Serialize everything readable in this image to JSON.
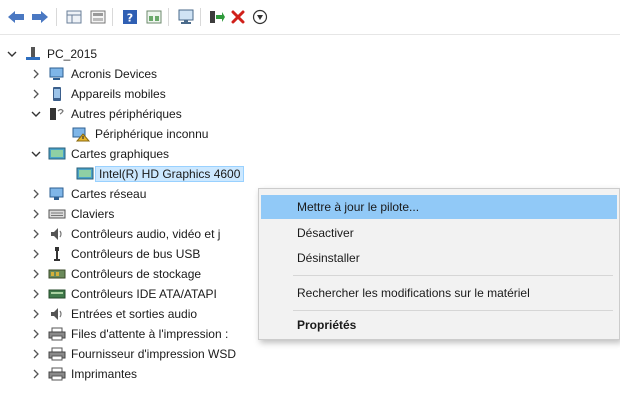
{
  "toolbar": {
    "buttons": [
      {
        "icon": "back-arrow-icon"
      },
      {
        "icon": "forward-arrow-icon"
      },
      {
        "icon": "properties-grid-icon"
      },
      {
        "icon": "details-pane-icon"
      },
      {
        "icon": "help-icon"
      },
      {
        "icon": "view-icon"
      },
      {
        "icon": "monitor-scan-icon"
      },
      {
        "icon": "add-driver-icon"
      },
      {
        "icon": "uninstall-x-icon"
      },
      {
        "icon": "down-arrow-circle-icon"
      }
    ]
  },
  "tree": {
    "root": "PC_2015",
    "items": [
      {
        "label": "Acronis Devices",
        "state": "collapsed",
        "icon": "device-icon"
      },
      {
        "label": "Appareils mobiles",
        "state": "collapsed",
        "icon": "mobile-icon"
      },
      {
        "label": "Autres périphériques",
        "state": "expanded",
        "icon": "other-devices-icon"
      },
      {
        "label": "Périphérique inconnu",
        "state": "leaf",
        "icon": "unknown-device-icon"
      },
      {
        "label": "Cartes graphiques",
        "state": "expanded",
        "icon": "display-adapter-icon"
      },
      {
        "label": "Intel(R) HD Graphics 4600",
        "state": "leaf",
        "icon": "display-adapter-icon",
        "selected": true
      },
      {
        "label": "Cartes réseau",
        "state": "collapsed",
        "icon": "network-adapter-icon"
      },
      {
        "label": "Claviers",
        "state": "collapsed",
        "icon": "keyboard-icon"
      },
      {
        "label": "Contrôleurs audio, vidéo et j",
        "state": "collapsed",
        "icon": "speaker-icon"
      },
      {
        "label": "Contrôleurs de bus USB",
        "state": "collapsed",
        "icon": "usb-icon"
      },
      {
        "label": "Contrôleurs de stockage",
        "state": "collapsed",
        "icon": "storage-controller-icon"
      },
      {
        "label": "Contrôleurs IDE ATA/ATAPI",
        "state": "collapsed",
        "icon": "ide-controller-icon"
      },
      {
        "label": "Entrées et sorties audio",
        "state": "collapsed",
        "icon": "speaker-icon"
      },
      {
        "label": "Files d'attente à l'impression :",
        "state": "collapsed",
        "icon": "printer-icon"
      },
      {
        "label": "Fournisseur d'impression WSD",
        "state": "collapsed",
        "icon": "printer-icon"
      },
      {
        "label": "Imprimantes",
        "state": "collapsed",
        "icon": "printer-icon"
      }
    ]
  },
  "context_menu": {
    "items": [
      {
        "label": "Mettre à jour le pilote...",
        "highlighted": true
      },
      {
        "label": "Désactiver"
      },
      {
        "label": "Désinstaller"
      },
      {
        "label": "Rechercher les modifications sur le matériel"
      },
      {
        "label": "Propriétés",
        "bold": true
      }
    ]
  },
  "colors": {
    "selection": "#cce8ff",
    "menu_highlight": "#91c9f7",
    "menu_bg": "#f2f2f2",
    "uninstall_red": "#d0201a",
    "back_arrow": "#4a78c2"
  }
}
